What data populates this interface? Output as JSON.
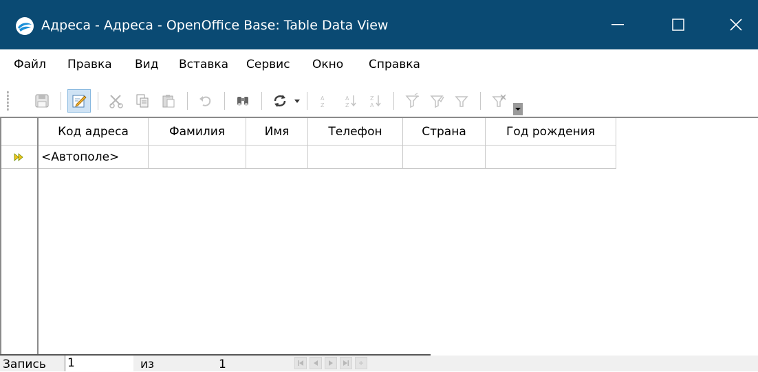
{
  "window": {
    "title": "Адреса - Адреса - OpenOffice Base: Table Data View",
    "title_bar_color": "#0a4a73"
  },
  "menu": {
    "items": [
      "Файл",
      "Правка",
      "Вид",
      "Вставка",
      "Сервис",
      "Окно",
      "Справка"
    ]
  },
  "toolbar": {
    "icons": [
      "save-icon",
      "edit-mode-icon",
      "cut-icon",
      "copy-icon",
      "paste-icon",
      "undo-icon",
      "find-icon",
      "refresh-icon",
      "sort-ascending-icon",
      "sort-descending-icon",
      "auto-filter-icon",
      "standard-filter-icon",
      "apply-filter-icon",
      "remove-filter-icon"
    ],
    "active": "edit-mode-icon"
  },
  "table": {
    "columns": [
      "Код адреса",
      "Фамилия",
      "Имя",
      "Телефон",
      "Страна",
      "Год рождения"
    ],
    "rows": [
      [
        "<Автополе>",
        "",
        "",
        "",
        "",
        ""
      ]
    ]
  },
  "navigation": {
    "record_label": "Запись",
    "record_value": "1",
    "of_label": "из",
    "total": "1"
  }
}
